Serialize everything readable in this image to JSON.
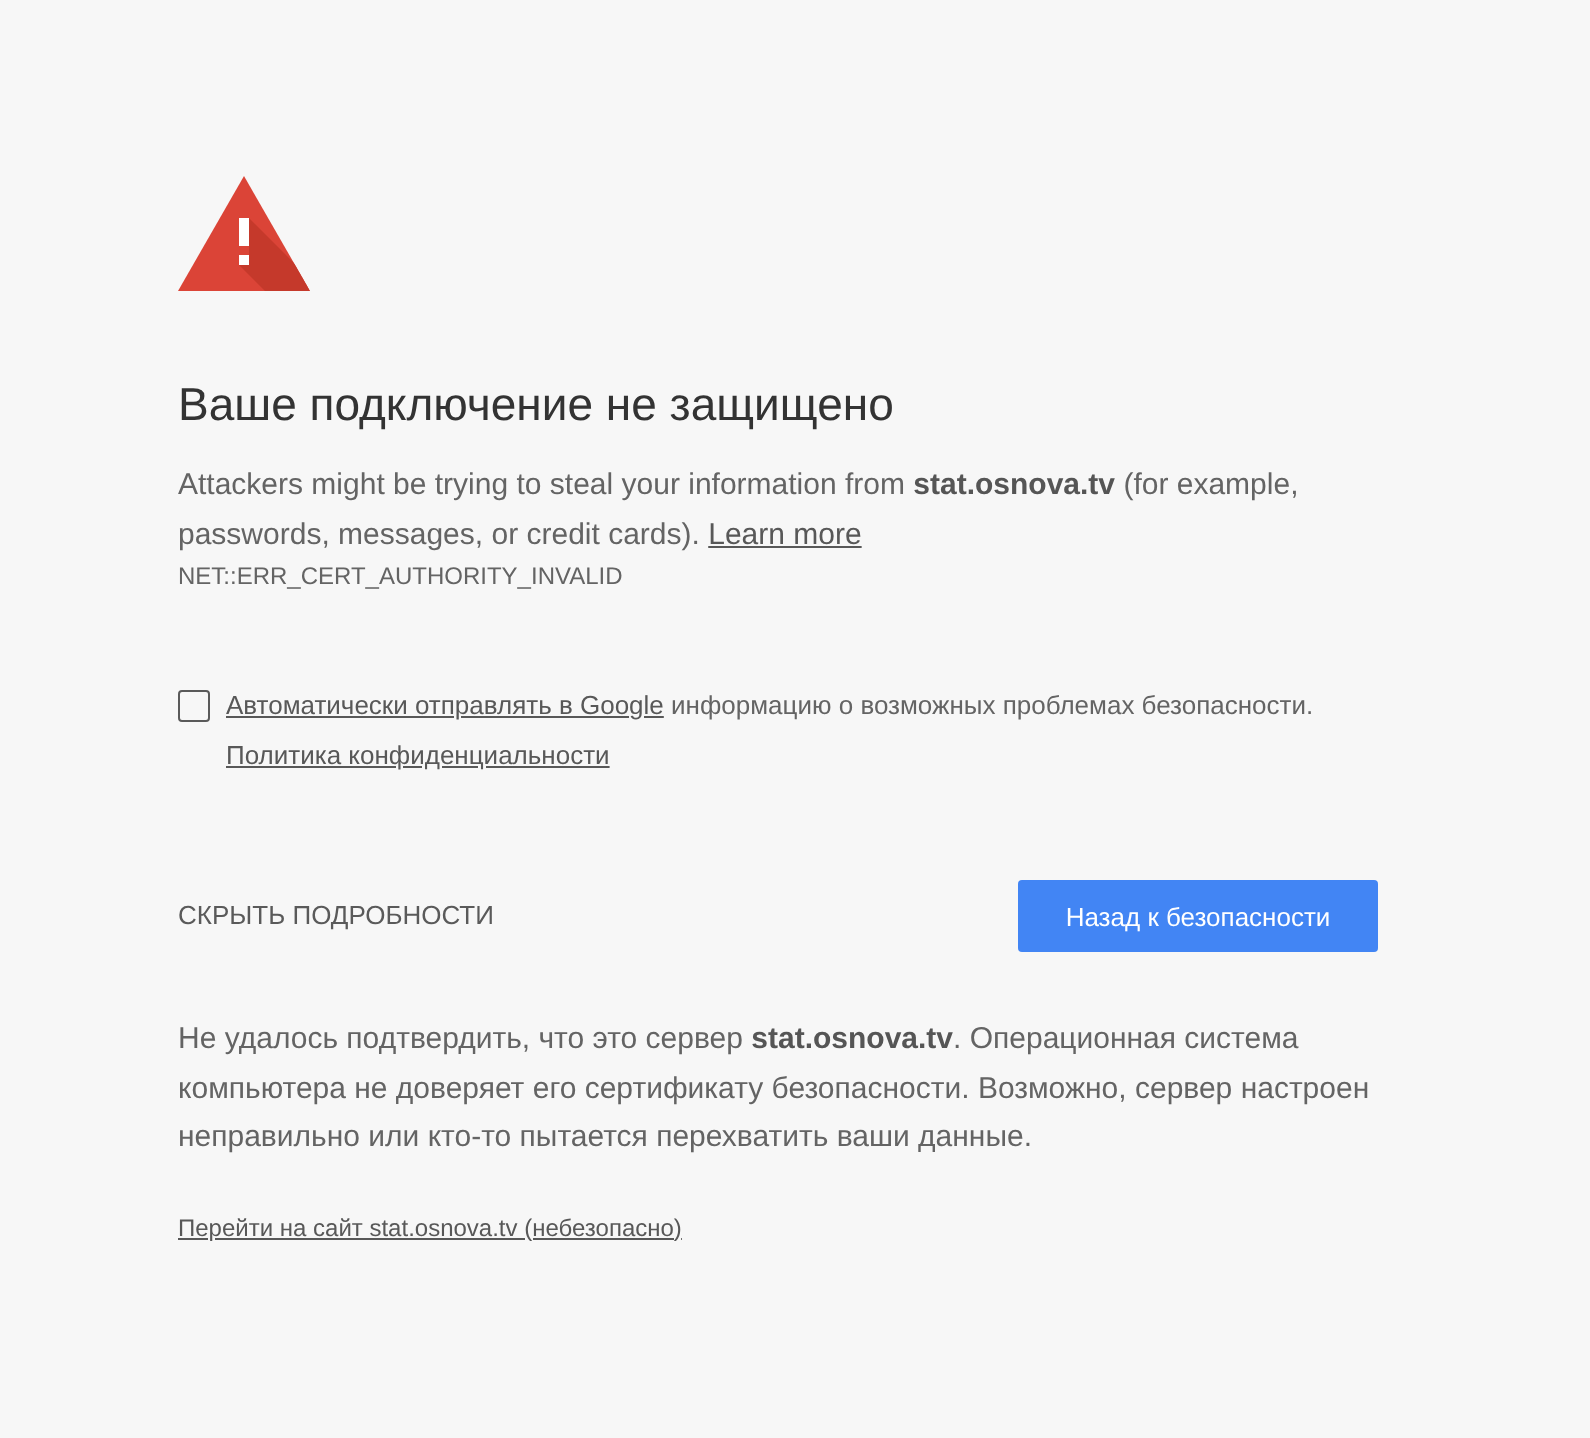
{
  "heading": "Ваше подключение не защищено",
  "main_message": {
    "text": "Attackers might be trying to steal your information from **stat.osnova.tv** (for example, passwords, messages, or credit cards).",
    "link": "Learn more"
  },
  "error_code": "NET::ERR_CERT_AUTHORITY_INVALID",
  "opt_in": {
    "checked": false,
    "link": "Автоматически отправлять в Google",
    "text": "информацию о возможных проблемах безопасности.",
    "privacy_link": "Политика конфиденциальности"
  },
  "details_button": "СКРЫТЬ ПОДРОБНОСТИ",
  "primary_button": "Назад к безопасности",
  "details": {
    "text": "Не удалось подтвердить, что это сервер **stat.osnova.tv**. Операционная система компьютера не доверяет его сертификату безопасности. Возможно, сервер настроен неправильно или кто-то пытается перехватить ваши данные.",
    "proceed_link": "Перейти на сайт stat.osnova.tv (небезопасно)"
  }
}
